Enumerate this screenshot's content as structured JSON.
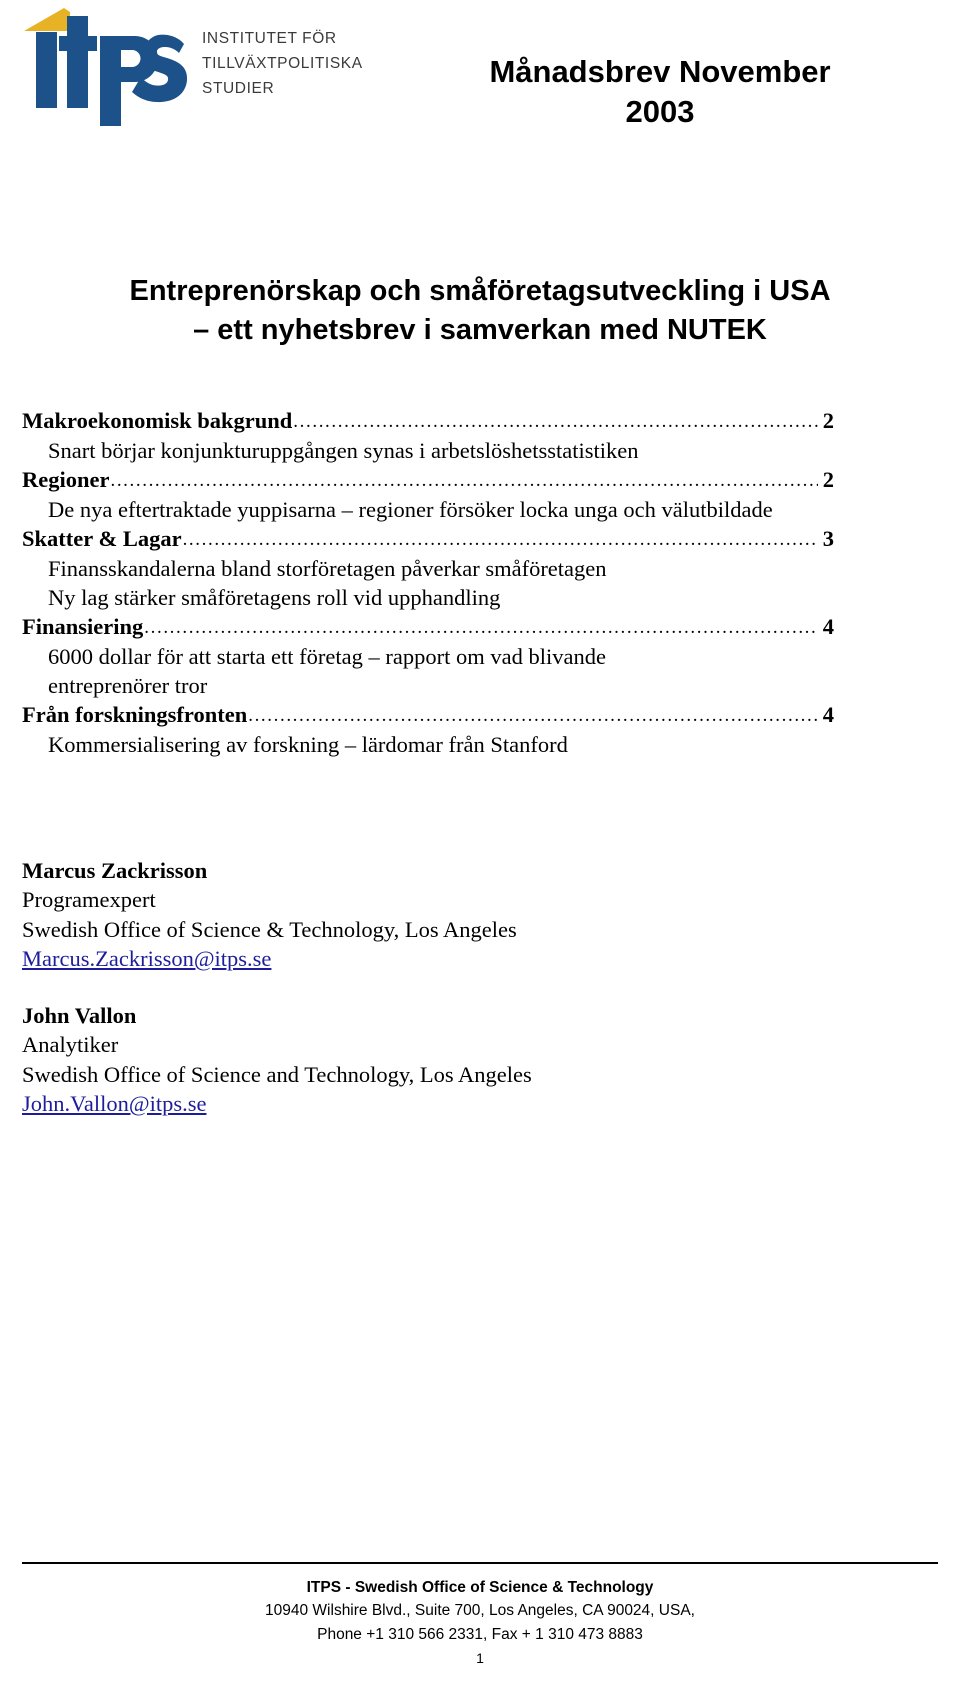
{
  "header": {
    "logo": {
      "wordmark": "itps",
      "accent_color": "#e8b226",
      "mark_color": "#1c5289",
      "institute_lines": [
        "INSTITUTET FÖR",
        "TILLVÄXTPOLITISKA",
        "STUDIER"
      ]
    },
    "doc_title_line1": "Månadsbrev November",
    "doc_title_line2": "2003"
  },
  "heading": {
    "line1": "Entreprenörskap och småföretagsutveckling i USA",
    "line2": "– ett nyhetsbrev i samverkan med NUTEK"
  },
  "toc": {
    "dots": "............................................................................................................................................................",
    "entries": [
      {
        "label": "Makroekonomisk bakgrund",
        "page": "2",
        "subs": [
          "Snart börjar konjunkturuppgången synas i arbetslöshetsstatistiken"
        ]
      },
      {
        "label": "Regioner",
        "page": "2",
        "subs": [
          "De nya eftertraktade yuppisarna – regioner försöker locka unga och välutbildade"
        ]
      },
      {
        "label": "Skatter & Lagar",
        "page": "3",
        "subs": [
          "Finansskandalerna bland storföretagen påverkar småföretagen",
          "Ny lag stärker småföretagens roll vid upphandling"
        ]
      },
      {
        "label": "Finansiering",
        "page": "4",
        "subs": [
          "6000 dollar för att starta ett företag – rapport om vad blivande entreprenörer tror"
        ]
      },
      {
        "label": "Från forskningsfronten",
        "page": "4",
        "subs": [
          "Kommersialisering av forskning – lärdomar från Stanford"
        ]
      }
    ]
  },
  "contacts": [
    {
      "name": "Marcus Zackrisson",
      "role": "Programexpert",
      "office": "Swedish Office of Science & Technology, Los Angeles",
      "email": "Marcus.Zackrisson@itps.se"
    },
    {
      "name": "John Vallon",
      "role": "Analytiker",
      "office": "Swedish Office of Science and Technology, Los Angeles",
      "email": "John.Vallon@itps.se"
    }
  ],
  "footer": {
    "org": "ITPS - Swedish Office of Science & Technology",
    "address": "10940 Wilshire Blvd., Suite 700, Los Angeles, CA 90024, USA,",
    "phone": "Phone +1 310 566 2331, Fax + 1 310 473 8883",
    "page_number": "1"
  }
}
